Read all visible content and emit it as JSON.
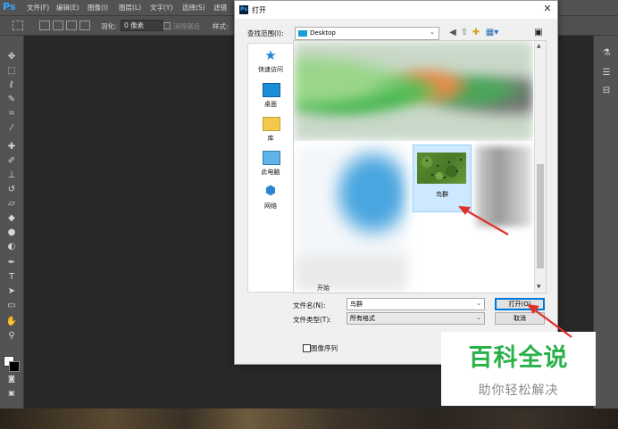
{
  "app": {
    "logo": "Ps",
    "menu": [
      "文件(F)",
      "编辑(E)",
      "图像(I)",
      "图层(L)",
      "文字(Y)",
      "选择(S)",
      "滤镜"
    ],
    "options": {
      "feather_label": "羽化:",
      "feather_value": "0 像素",
      "antialias_label": "消除锯齿",
      "style_label": "样式:"
    }
  },
  "dialog": {
    "title": "打开",
    "look_in_label": "查找范围(I):",
    "look_in_value": "Desktop",
    "places": [
      {
        "label": "快速访问",
        "icon": "star-icon"
      },
      {
        "label": "桌面",
        "icon": "desktop-icon"
      },
      {
        "label": "库",
        "icon": "library-icon"
      },
      {
        "label": "此电脑",
        "icon": "computer-icon"
      },
      {
        "label": "网络",
        "icon": "network-icon"
      }
    ],
    "selected_file_label": "鸟群",
    "partial_file_label": "开始",
    "file_name_label": "文件名(N):",
    "file_name_value": "鸟群",
    "file_type_label": "文件类型(T):",
    "file_type_value": "所有格式",
    "open_button": "打开(O)",
    "cancel_button": "取消",
    "sequence_label": "图像序列"
  },
  "watermark": {
    "title": "百科全说",
    "subtitle": "助你轻松解决"
  },
  "colors": {
    "accent": "#0078d7",
    "annotation_arrow": "#e0302a",
    "watermark_green": "#2bb14a"
  }
}
